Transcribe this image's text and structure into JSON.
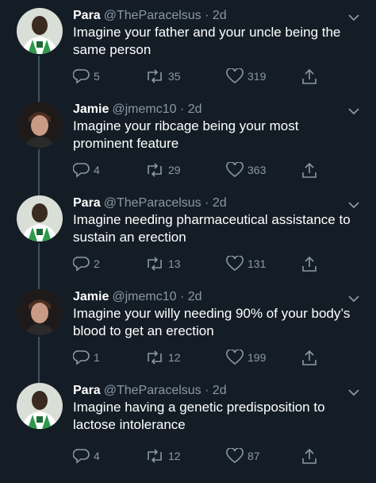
{
  "tweets": [
    {
      "author": "Para",
      "handle": "@TheParacelsus",
      "time": "2d",
      "text": "Imagine your father and your uncle being the same person",
      "replies": "5",
      "retweets": "35",
      "likes": "319",
      "avatar": "para-avatar"
    },
    {
      "author": "Jamie",
      "handle": "@jmemc10",
      "time": "2d",
      "text": "Imagine your ribcage being your most prominent feature",
      "replies": "4",
      "retweets": "29",
      "likes": "363",
      "avatar": "jamie-avatar"
    },
    {
      "author": "Para",
      "handle": "@TheParacelsus",
      "time": "2d",
      "text": "Imagine needing pharmaceutical assistance to sustain an erection",
      "replies": "2",
      "retweets": "13",
      "likes": "131",
      "avatar": "para-avatar"
    },
    {
      "author": "Jamie",
      "handle": "@jmemc10",
      "time": "2d",
      "text": "Imagine your willy needing 90% of your body’s blood to get an erection",
      "replies": "1",
      "retweets": "12",
      "likes": "199",
      "avatar": "jamie-avatar"
    },
    {
      "author": "Para",
      "handle": "@TheParacelsus",
      "time": "2d",
      "text": "Imagine having a genetic predisposition to lactose intolerance",
      "replies": "4",
      "retweets": "12",
      "likes": "87",
      "avatar": "para-avatar"
    }
  ],
  "colors": {
    "background": "#141d26",
    "text": "#ffffff",
    "secondary": "#8899a6",
    "thread_line": "#3d5466"
  },
  "icons": [
    "reply-icon",
    "retweet-icon",
    "like-icon",
    "share-icon",
    "chevron-down-icon"
  ]
}
